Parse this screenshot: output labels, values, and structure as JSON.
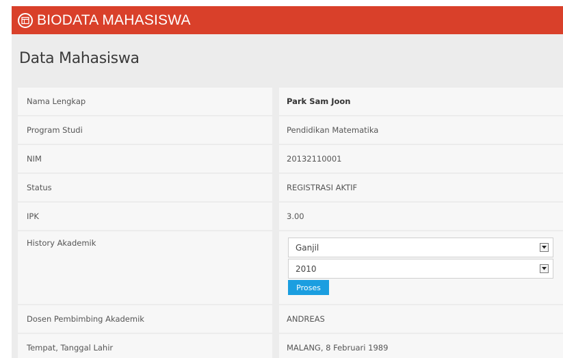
{
  "header": {
    "title": "BIODATA MAHASISWA",
    "icon": "calendar-icon",
    "color": "#d9402a"
  },
  "section": {
    "title": "Data Mahasiswa"
  },
  "fields": {
    "nama": {
      "label": "Nama Lengkap",
      "value": "Park Sam Joon"
    },
    "prodi": {
      "label": "Program Studi",
      "value": "Pendidikan Matematika"
    },
    "nim": {
      "label": "NIM",
      "value": "20132110001"
    },
    "status": {
      "label": "Status",
      "value": "REGISTRASI AKTIF"
    },
    "ipk": {
      "label": "IPK",
      "value": "3.00"
    },
    "history": {
      "label": "History Akademik",
      "semester_selected": "Ganjil",
      "year_selected": "2010",
      "button_label": "Proses",
      "button_color": "#1b9ee0"
    },
    "dosen": {
      "label": "Dosen Pembimbing Akademik",
      "value": "ANDREAS"
    },
    "ttl": {
      "label": "Tempat, Tanggal Lahir",
      "value": "MALANG, 8 Februari 1989"
    }
  }
}
